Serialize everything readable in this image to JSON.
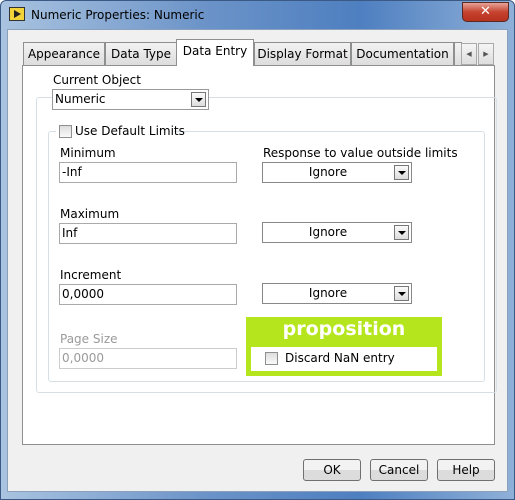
{
  "window": {
    "title": "Numeric Properties: Numeric",
    "close_label": "✕"
  },
  "tabs": [
    {
      "label": "Appearance"
    },
    {
      "label": "Data Type"
    },
    {
      "label": "Data Entry",
      "active": true
    },
    {
      "label": "Display Format"
    },
    {
      "label": "Documentation"
    }
  ],
  "tab_scroll": {
    "left": "◀",
    "right": "▶"
  },
  "current_object": {
    "label": "Current Object",
    "value": "Numeric"
  },
  "use_default_limits": {
    "label": "Use Default Limits",
    "checked": false
  },
  "minimum": {
    "label": "Minimum",
    "value": "-Inf"
  },
  "maximum": {
    "label": "Maximum",
    "value": "Inf"
  },
  "increment": {
    "label": "Increment",
    "value": "0,0000"
  },
  "page_size": {
    "label": "Page Size",
    "value": "0,0000",
    "disabled": true
  },
  "response_label": "Response to value outside limits",
  "responses": [
    "Ignore",
    "Ignore",
    "Ignore"
  ],
  "proposition": {
    "title": "proposition",
    "color": "#b5e61d",
    "discard_nan_label": "Discard NaN entry",
    "checked": false
  },
  "buttons": {
    "ok": "OK",
    "cancel": "Cancel",
    "help": "Help"
  }
}
